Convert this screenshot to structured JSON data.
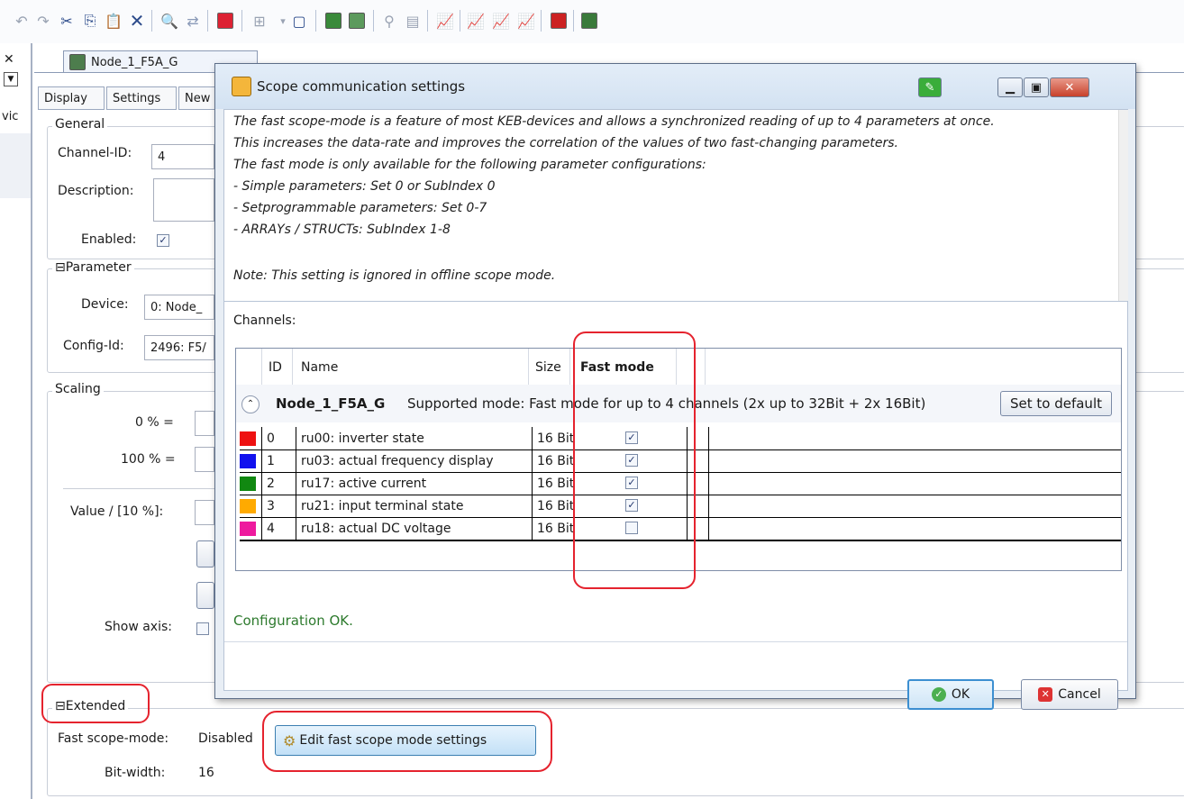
{
  "toolbar": {
    "icons": [
      "undo-icon",
      "redo-icon",
      "cut-icon",
      "copy-icon",
      "paste-icon",
      "delete-icon",
      "find-icon",
      "replace-icon",
      "keb-device-icon",
      "insert-icon",
      "new-document-icon",
      "scope-icon",
      "scope-settings-icon",
      "link-icon",
      "device-info-icon",
      "chart-icon",
      "chart-add-icon",
      "chart-edit-icon",
      "chart-remove-icon",
      "keb-parameter-icon",
      "keb-network-icon"
    ]
  },
  "leftstrip": {
    "partial_text": "vic"
  },
  "editor": {
    "tabs": [
      {
        "label": "Node_1_F5A_G"
      }
    ],
    "subtabs": [
      "Display",
      "Settings",
      "New"
    ],
    "general": {
      "title": "General",
      "channel_id_label": "Channel-ID:",
      "channel_id_value": "4",
      "description_label": "Description:",
      "description_value": "",
      "enabled_label": "Enabled:",
      "enabled_checked": true
    },
    "parameter": {
      "title": "Parameter",
      "device_label": "Device:",
      "device_value": "0: Node_",
      "config_label": "Config-Id:",
      "config_value": "2496: F5/"
    },
    "scaling": {
      "title": "Scaling",
      "zero_label": "0 % =",
      "hundred_label": "100 % =",
      "value_label": "Value / [10 %]:",
      "show_axis_label": "Show axis:"
    },
    "extended": {
      "title": "Extended",
      "fast_scope_label": "Fast scope-mode:",
      "fast_scope_value": "Disabled",
      "edit_button": "Edit fast scope mode settings",
      "bitwidth_label": "Bit-width:",
      "bitwidth_value": "16"
    }
  },
  "dialog": {
    "title": "Scope communication settings",
    "info_lines": [
      "The fast scope-mode is a feature of most KEB-devices and allows a synchronized reading of up to 4 parameters at once.",
      "This increases the data-rate and improves the correlation of the values of two fast-changing parameters.",
      "The fast mode is only available for the following parameter configurations:",
      "- Simple parameters: Set 0 or SubIndex 0",
      "- Setprogrammable parameters: Set 0-7",
      "- ARRAYs / STRUCTs: SubIndex 1-8"
    ],
    "note": "Note: This setting is ignored in offline scope mode.",
    "channels_label": "Channels:",
    "columns": {
      "id": "ID",
      "name": "Name",
      "size": "Size",
      "fast_mode": "Fast mode"
    },
    "group": {
      "node": "Node_1_F5A_G",
      "mode_text": "Supported mode: Fast mode for up to 4 channels (2x up to 32Bit + 2x 16Bit)",
      "set_default": "Set to default"
    },
    "channels": [
      {
        "color": "#ee1111",
        "id": "0",
        "name": "ru00: inverter state",
        "size": "16 Bit",
        "fast": true
      },
      {
        "color": "#1111ee",
        "id": "1",
        "name": "ru03: actual frequency display",
        "size": "16 Bit",
        "fast": true
      },
      {
        "color": "#118811",
        "id": "2",
        "name": "ru17: active current",
        "size": "16 Bit",
        "fast": true
      },
      {
        "color": "#ffaa00",
        "id": "3",
        "name": "ru21: input terminal state",
        "size": "16 Bit",
        "fast": true
      },
      {
        "color": "#ee1a9e",
        "id": "4",
        "name": "ru18: actual DC voltage",
        "size": "16 Bit",
        "fast": false
      }
    ],
    "status": "Configuration OK.",
    "status_color": "#2d7a2d",
    "ok": "OK",
    "cancel": "Cancel"
  },
  "colors": {
    "highlight": "#e5232e",
    "accent": "#2b4a8a"
  }
}
